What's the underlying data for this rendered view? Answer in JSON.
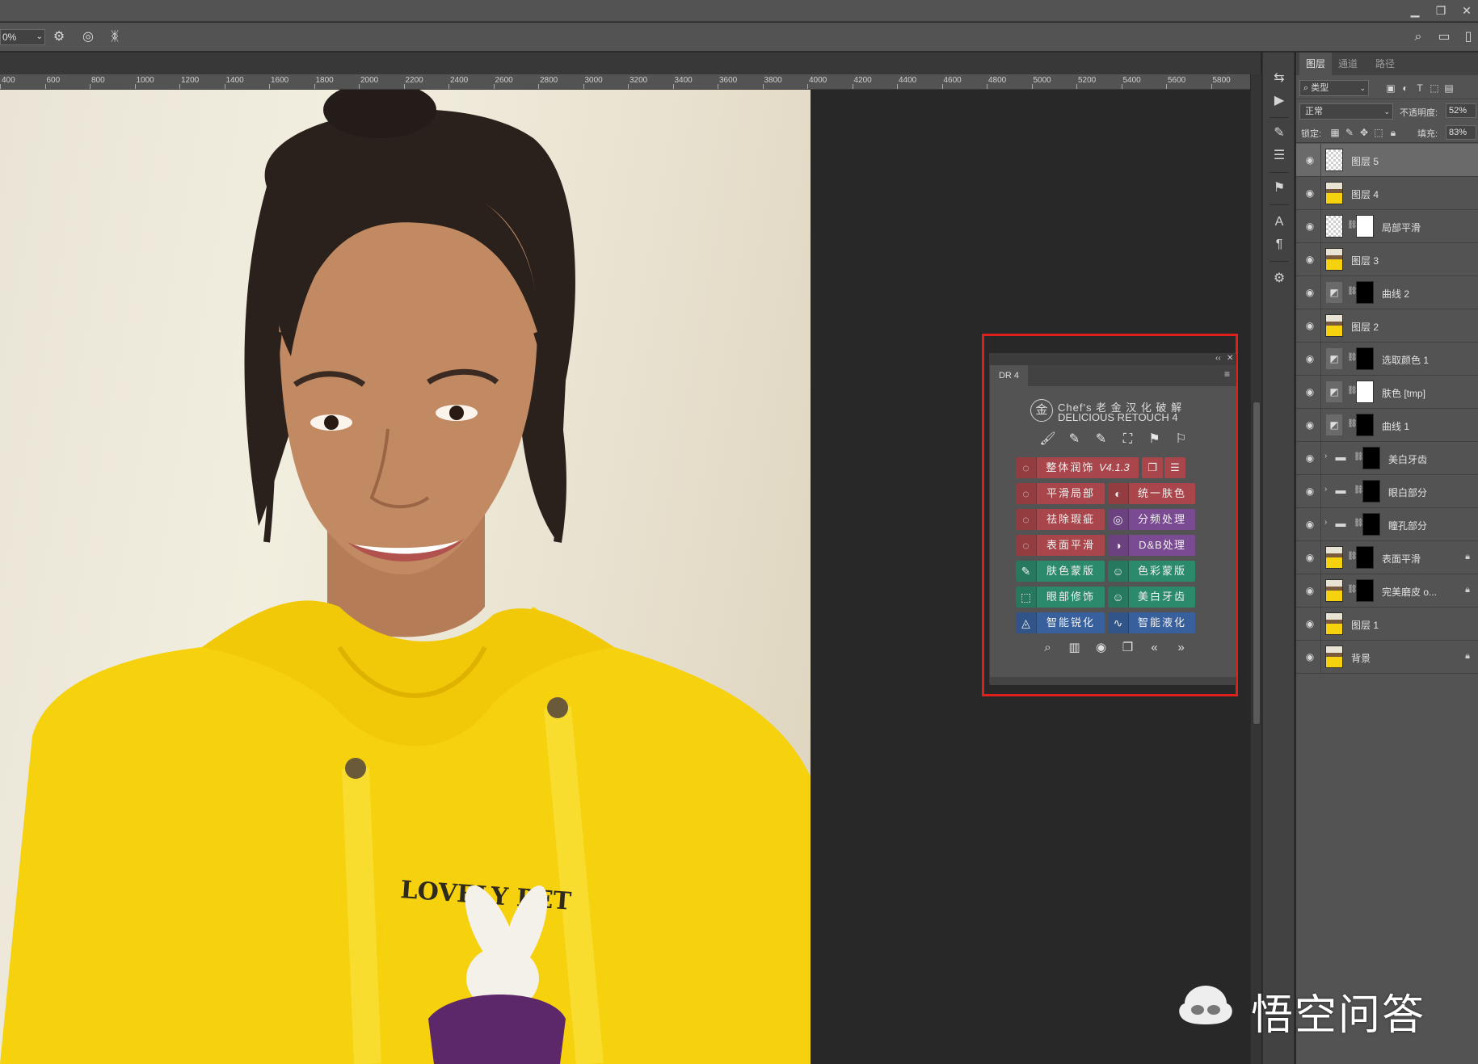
{
  "window": {
    "minimize_glyph": "▁",
    "restore_glyph": "❐",
    "close_glyph": "✕"
  },
  "options_bar": {
    "zoom_value": "0%"
  },
  "ruler": {
    "ticks": [
      "400",
      "600",
      "800",
      "1000",
      "1200",
      "1400",
      "1600",
      "1800",
      "2000",
      "2200",
      "2400",
      "2600",
      "2800",
      "3000",
      "3200",
      "3400",
      "3600",
      "3800",
      "4000",
      "4200",
      "4400",
      "4600",
      "4800",
      "5000",
      "5200",
      "5400",
      "5600",
      "5800"
    ]
  },
  "dr4": {
    "tab_label": "DR 4",
    "collapse_glyph": "‹‹",
    "close_glyph": "✕",
    "menu_glyph": "≡",
    "logo_glyph": "金",
    "logo_line1": "Chef's 老 金 汉 化 破 解",
    "logo_line2": "DELICIOUS RETOUCH 4",
    "top_tools": [
      "🖌",
      "✎",
      "✎",
      "⛶",
      "⚑",
      "⚐"
    ],
    "buttons": [
      {
        "label": "整体润饰",
        "version": "V4.1.3",
        "color": "red",
        "icon": "◌"
      },
      {
        "label": "平滑局部",
        "color": "red",
        "icon": "◌"
      },
      {
        "label": "统一肤色",
        "color": "red",
        "icon": "◐"
      },
      {
        "label": "祛除瑕疵",
        "color": "red",
        "icon": "◌"
      },
      {
        "label": "分频处理",
        "color": "purple",
        "icon": "◎"
      },
      {
        "label": "表面平滑",
        "color": "red",
        "icon": "◌"
      },
      {
        "label": "D&B处理",
        "color": "purple",
        "icon": "◑"
      },
      {
        "label": "肤色蒙版",
        "color": "green",
        "icon": "✎"
      },
      {
        "label": "色彩蒙版",
        "color": "green",
        "icon": "☺"
      },
      {
        "label": "眼部修饰",
        "color": "green",
        "icon": "⬚"
      },
      {
        "label": "美白牙齿",
        "color": "green",
        "icon": "☺"
      },
      {
        "label": "智能锐化",
        "color": "blue",
        "icon": "◬"
      },
      {
        "label": "智能液化",
        "color": "blue",
        "icon": "∿"
      }
    ],
    "bottom_tools": [
      "⌕",
      "▥",
      "◉",
      "❐",
      "«",
      "»"
    ]
  },
  "layers_panel": {
    "tabs": [
      "图层",
      "通道",
      "路径"
    ],
    "kind_filter": "类型",
    "blend_mode": "正常",
    "opacity_label": "不透明度:",
    "opacity_value": "52%",
    "lock_label": "锁定:",
    "fill_label": "填充:",
    "fill_value": "83%",
    "layers": [
      {
        "name": "图层 5",
        "thumb": "trans",
        "selected": true
      },
      {
        "name": "图层 4",
        "thumb": "photo"
      },
      {
        "name": "局部平滑",
        "thumb": "trans",
        "mask": "white"
      },
      {
        "name": "图层 3",
        "thumb": "photo"
      },
      {
        "name": "曲线 2",
        "thumb": "adj",
        "mask": "black"
      },
      {
        "name": "图层 2",
        "thumb": "photo"
      },
      {
        "name": "选取颜色 1",
        "thumb": "adj",
        "mask": "black"
      },
      {
        "name": "肤色 [tmp]",
        "thumb": "adj",
        "mask": "white"
      },
      {
        "name": "曲线 1",
        "thumb": "adj",
        "mask": "black"
      },
      {
        "name": "美白牙齿",
        "thumb": "folder",
        "mask": "black"
      },
      {
        "name": "眼白部分",
        "thumb": "folder",
        "mask": "black"
      },
      {
        "name": "瞳孔部分",
        "thumb": "folder",
        "mask": "black"
      },
      {
        "name": "表面平滑",
        "thumb": "photo",
        "mask": "black",
        "locked": true
      },
      {
        "name": "完美磨皮 o...",
        "thumb": "photo",
        "mask": "black",
        "locked": true
      },
      {
        "name": "图层 1",
        "thumb": "photo"
      },
      {
        "name": "背景",
        "thumb": "photo",
        "locked": true
      }
    ]
  },
  "watermark": {
    "text": "悟空问答"
  },
  "colors": {
    "button_red": "#a8464b",
    "button_purple": "#7a4b92",
    "button_green": "#2c8a6c",
    "button_blue": "#38609c",
    "highlight_box": "#e0201c",
    "hoodie_yellow": "#f5d10e"
  }
}
